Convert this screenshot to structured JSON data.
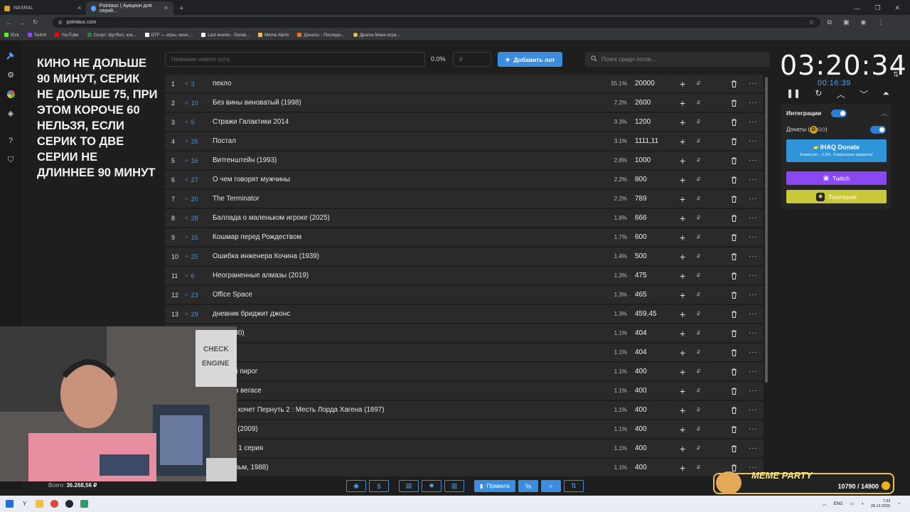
{
  "browser": {
    "tabs": [
      {
        "label": "NASRAL",
        "color": "#e0a030"
      },
      {
        "label": "Pointauc | Аукцион для серий...",
        "color": "#4aa3ff"
      }
    ],
    "url": "pointauc.com",
    "bookmarks": [
      {
        "label": "Kick",
        "color": "#53fc18"
      },
      {
        "label": "Twitch",
        "color": "#9146ff"
      },
      {
        "label": "YouTube",
        "color": "#ff0000"
      },
      {
        "label": "Спорт: футбол, хок...",
        "color": "#2a7f3a"
      },
      {
        "label": "DTF — игры, кино,...",
        "color": "#ffffff"
      },
      {
        "label": "Last events - Donat...",
        "color": "#ffffff"
      },
      {
        "label": "Meme Alerts",
        "color": "#f0c040"
      },
      {
        "label": "Донаты - Последн...",
        "color": "#f07020"
      },
      {
        "label": "Драгон Мани игра...",
        "color": "#f0c040"
      }
    ]
  },
  "notes": "КИНО НЕ ДОЛЬШЕ 90 МИНУТ, СЕРИК НЕ ДОЛЬШЕ 75, ПРИ ЭТОМ КОРОЧЕ 60 НЕЛЬЗЯ, ЕСЛИ СЕРИК ТО ДВЕ СЕРИИ НЕ ДЛИННЕЕ 90 МИНУТ",
  "controls": {
    "lot_placeholder": "Название нового лота",
    "pct": "0.0%",
    "amount_placeholder": "₽",
    "add_button": "Добавить лот",
    "search_placeholder": "Поиск среди лотов..."
  },
  "lots": [
    {
      "n": "1",
      "id": "3",
      "name": "пекло",
      "pct": "55.1%",
      "amount": "20000"
    },
    {
      "n": "2",
      "id": "10",
      "name": "Без вины виноватый (1998)",
      "pct": "7.2%",
      "amount": "2600"
    },
    {
      "n": "3",
      "id": "5",
      "name": "Стражи Галактики 2014",
      "pct": "3.3%",
      "amount": "1200"
    },
    {
      "n": "4",
      "id": "26",
      "name": "Постал",
      "pct": "3.1%",
      "amount": "1111,11"
    },
    {
      "n": "5",
      "id": "16",
      "name": "Витгенштейн (1993)",
      "pct": "2.8%",
      "amount": "1000"
    },
    {
      "n": "6",
      "id": "27",
      "name": "О чем говорят мужчины",
      "pct": "2.2%",
      "amount": "800"
    },
    {
      "n": "7",
      "id": "20",
      "name": "The Terminator",
      "pct": "2.2%",
      "amount": "789"
    },
    {
      "n": "8",
      "id": "28",
      "name": "Баллада о маленьком игроке (2025)",
      "pct": "1.8%",
      "amount": "666"
    },
    {
      "n": "9",
      "id": "15",
      "name": "Кошмар перед Рождеством",
      "pct": "1.7%",
      "amount": "600"
    },
    {
      "n": "10",
      "id": "25",
      "name": "Ошибка инженера Кочина (1939)",
      "pct": "1.4%",
      "amount": "500"
    },
    {
      "n": "11",
      "id": "6",
      "name": "Неограненные алмазы (2019)",
      "pct": "1.3%",
      "amount": "475"
    },
    {
      "n": "12",
      "id": "23",
      "name": "Office Space",
      "pct": "1.3%",
      "amount": "465"
    },
    {
      "n": "13",
      "id": "29",
      "name": "дневник бриджит джонс",
      "pct": "1.3%",
      "amount": "459,45"
    },
    {
      "n": "",
      "id": "",
      "name": "trip (2000)",
      "pct": "1.1%",
      "amount": "404"
    },
    {
      "n": "",
      "id": "",
      "name": "енция",
      "pct": "1.1%",
      "amount": "404"
    },
    {
      "n": "",
      "id": "",
      "name": "канский пирог",
      "pct": "1.1%",
      "amount": "400"
    },
    {
      "n": "",
      "id": "",
      "name": "ишник в вегасе",
      "pct": "1.1%",
      "amount": "400"
    },
    {
      "n": "",
      "id": "",
      "name": "ан Фум хочет Пернуть 2 : Месть Лорда Хагена (1897)",
      "pct": "1.1%",
      "amount": "400"
    },
    {
      "n": "",
      "id": "",
      "name": "umpers (2009)",
      "pct": "1.1%",
      "amount": "400"
    },
    {
      "n": "",
      "id": "",
      "name": "2 сезон 1 серия",
      "pct": "1.1%",
      "amount": "400"
    },
    {
      "n": "",
      "id": "",
      "name": "ой (фильм, 1988)",
      "pct": "1.1%",
      "amount": "400"
    }
  ],
  "currency": "₽",
  "timer": {
    "main": "03:20:34",
    "sub": "00:16:39"
  },
  "integrations": {
    "title": "Интеграции",
    "donates_label": "Донаты (",
    "donates_suffix": ")",
    "ihaq_title": "IHAQ Donate",
    "ihaq_sub": "Комиссия – 3,5%. Уникальные виджеты!",
    "twitch": "Twitch",
    "tourni": "Tourniquet"
  },
  "bottom": {
    "total_label": "Всего:",
    "total_value": "36.268,56 ₽",
    "rules_label": "Правила"
  },
  "meme_party": {
    "title": "MEME PARTY",
    "count": "10790 / 14900"
  },
  "taskbar": {
    "lang": "ENG",
    "time": "7:33",
    "date": "28.12.2025"
  }
}
